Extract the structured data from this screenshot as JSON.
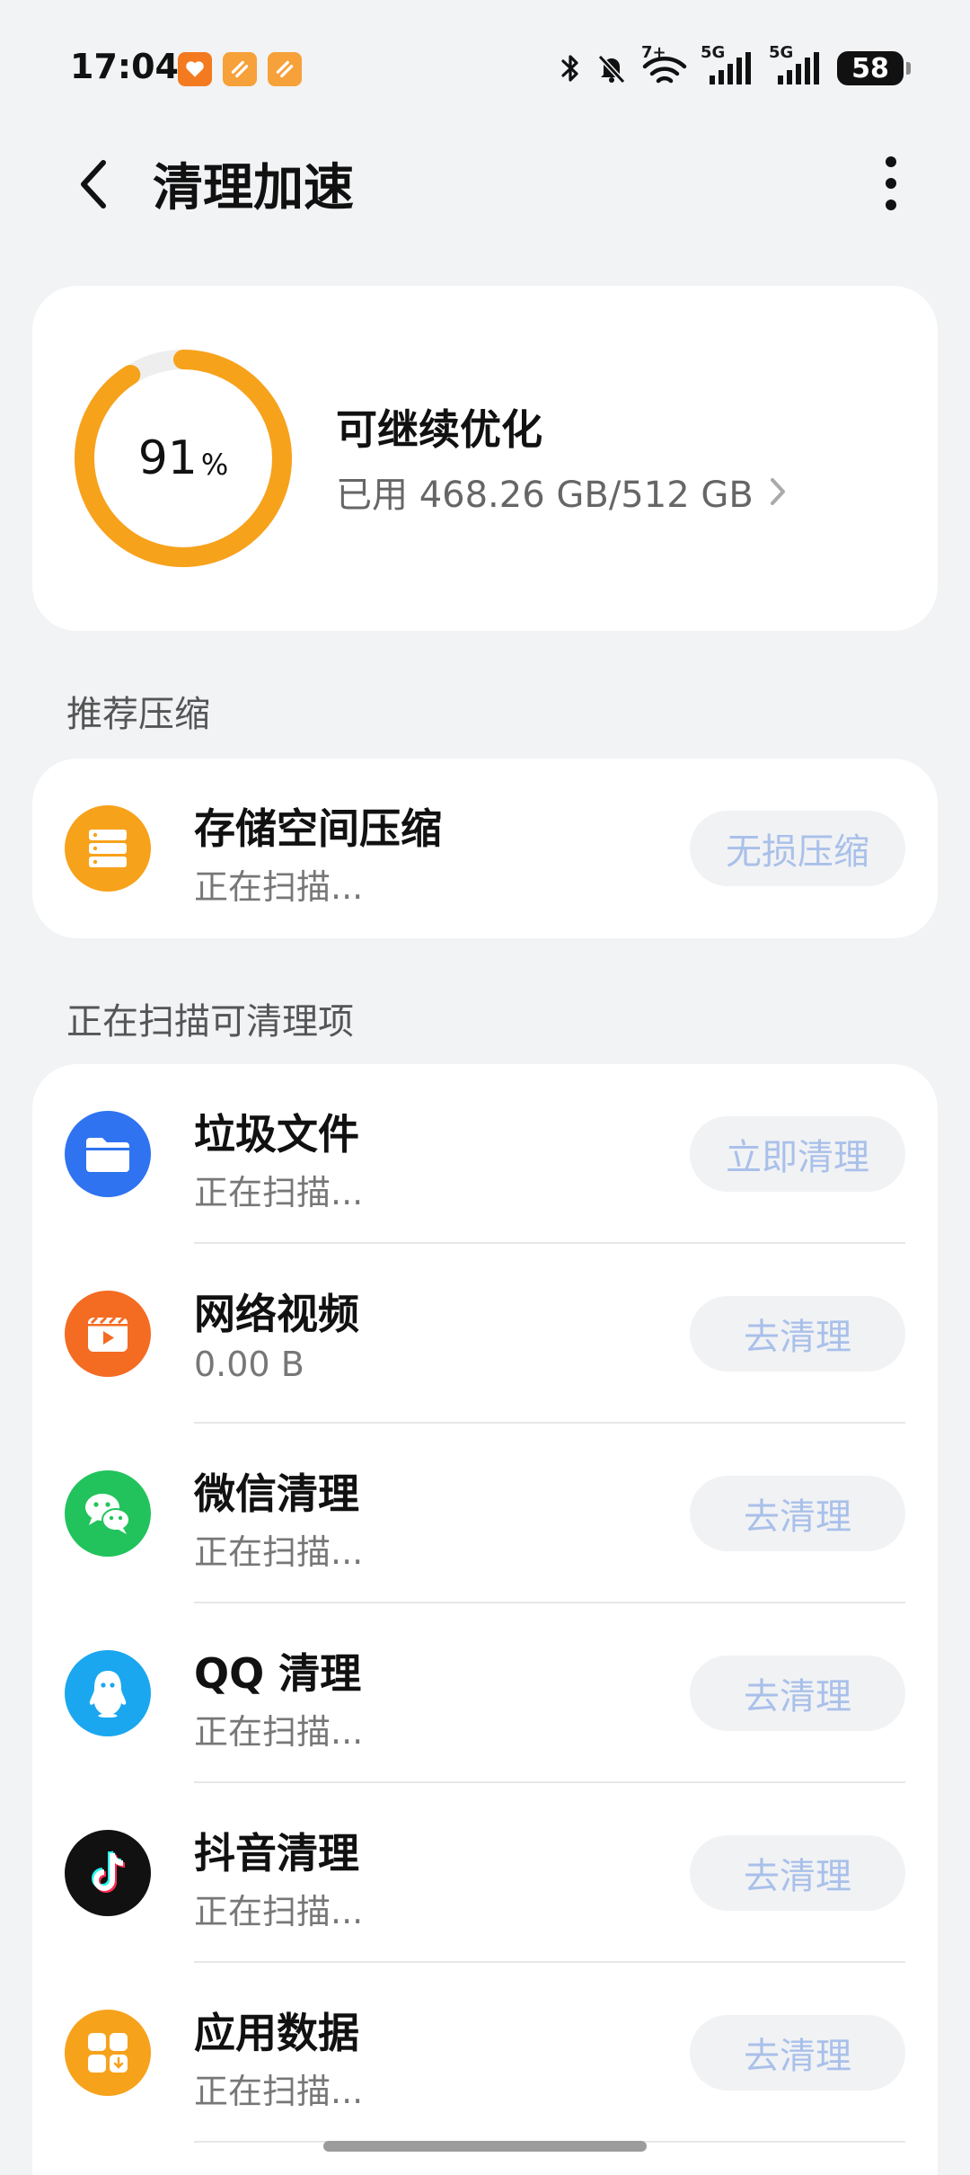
{
  "status_bar": {
    "time": "17:04",
    "network_1": "5G",
    "network_2": "5G",
    "wifi_badge": "7+",
    "battery": "58"
  },
  "header": {
    "title": "清理加速"
  },
  "storage": {
    "percent": "91",
    "percent_unit": "%",
    "fill_fraction": 0.91,
    "status": "可继续优化",
    "used_text": "已用 468.26 GB/512 GB"
  },
  "sections": {
    "recommend": "推荐压缩",
    "scanning": "正在扫描可清理项"
  },
  "compress_item": {
    "title": "存储空间压缩",
    "subtitle": "正在扫描...",
    "button": "无损压缩"
  },
  "clean_items": [
    {
      "title": "垃圾文件",
      "subtitle": "正在扫描...",
      "button": "立即清理",
      "icon": "folder-icon",
      "color": "#2F73F0"
    },
    {
      "title": "网络视频",
      "subtitle": "0.00 B",
      "button": "去清理",
      "icon": "video-icon",
      "color": "#F46B22"
    },
    {
      "title": "微信清理",
      "subtitle": "正在扫描...",
      "button": "去清理",
      "icon": "wechat-icon",
      "color": "#22C35C"
    },
    {
      "title": "QQ 清理",
      "subtitle": "正在扫描...",
      "button": "去清理",
      "icon": "qq-icon",
      "color": "#1AA7EF"
    },
    {
      "title": "抖音清理",
      "subtitle": "正在扫描...",
      "button": "去清理",
      "icon": "tiktok-icon",
      "color": "#111111"
    },
    {
      "title": "应用数据",
      "subtitle": "正在扫描...",
      "button": "去清理",
      "icon": "apps-icon",
      "color": "#F7A21B"
    }
  ],
  "colors": {
    "accent_orange": "#F7A21B",
    "button_text": "#A9C0EA",
    "background": "#F1F3F5"
  }
}
